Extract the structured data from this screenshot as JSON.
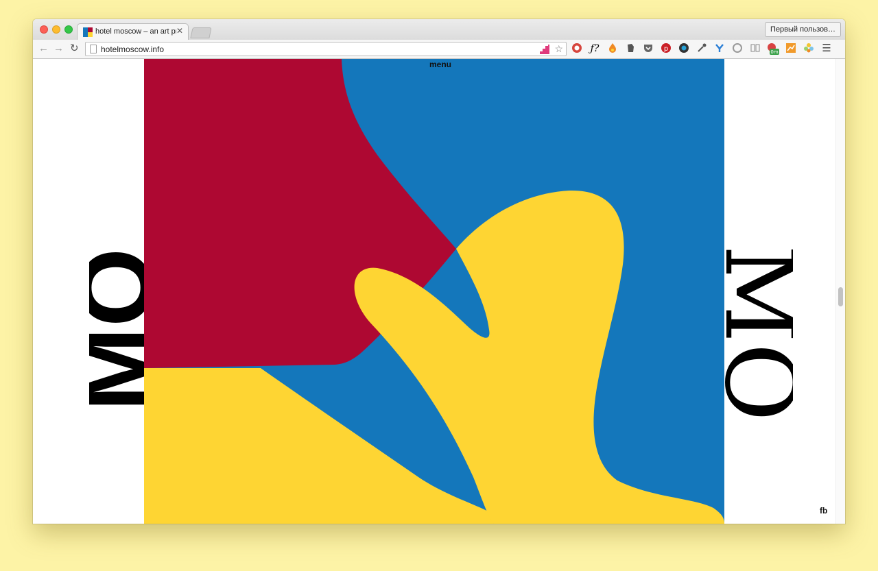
{
  "browser": {
    "tab_title": "hotel moscow – an art proj",
    "profile": "Первый пользов…",
    "url": "hotelmoscow.info",
    "extensions": [
      "pocket-stairs-icon",
      "star-icon",
      "ublock-icon",
      "font-f-icon",
      "flame-icon",
      "evernote-icon",
      "pocket-icon",
      "pinterest-icon",
      "camera-icon",
      "eyedropper-icon",
      "y-icon",
      "refresh-circle-icon",
      "reader-icon",
      "badge-0m-icon",
      "chart-icon",
      "flower-icon",
      "menu-icon"
    ]
  },
  "page": {
    "menu": "menu",
    "fb": "fb",
    "left_vertical_text": "MO",
    "right_vertical_text": "MO",
    "colors": {
      "red": "#ae0832",
      "blue": "#1477bb",
      "yellow": "#fed533"
    }
  }
}
